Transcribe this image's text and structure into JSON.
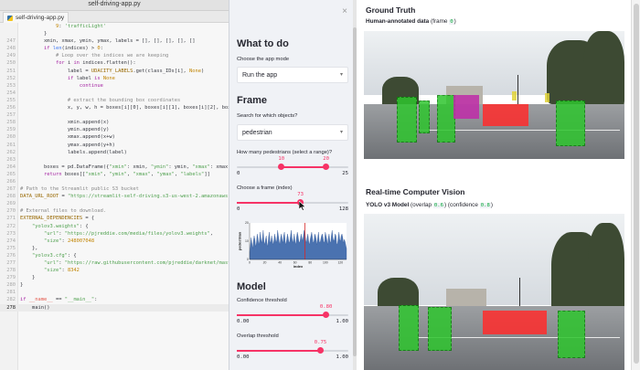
{
  "editor": {
    "window_title": "self-driving-app.py",
    "tab_label": "self-driving-app.py",
    "lines": [
      {
        "n": "",
        "t": [
          [
            "tk-p",
            "            "
          ],
          [
            "tk-n",
            "9"
          ],
          [
            "tk-p",
            ": "
          ],
          [
            "tk-s",
            "'trafficLight'"
          ]
        ]
      },
      {
        "n": "",
        "t": [
          [
            "tk-p",
            "        }"
          ]
        ]
      },
      {
        "n": "247",
        "t": [
          [
            "tk-p",
            "        xmin, xmax, ymin, ymax, labels = [], [], [], [], []"
          ]
        ]
      },
      {
        "n": "248",
        "t": [
          [
            "tk-k",
            "        if "
          ],
          [
            "tk-f",
            "len"
          ],
          [
            "tk-p",
            "(indices) > "
          ],
          [
            "tk-n",
            "0"
          ],
          [
            "tk-p",
            ":"
          ]
        ]
      },
      {
        "n": "249",
        "t": [
          [
            "tk-c",
            "            # Loop over the indices we are keeping"
          ]
        ]
      },
      {
        "n": "250",
        "t": [
          [
            "tk-k",
            "            for "
          ],
          [
            "tk-p",
            "i "
          ],
          [
            "tk-k",
            "in "
          ],
          [
            "tk-p",
            "indices.flatten():"
          ]
        ]
      },
      {
        "n": "251",
        "t": [
          [
            "tk-p",
            "                label = "
          ],
          [
            "tk-x",
            "UDACITY_LABELS"
          ],
          [
            "tk-p",
            ".get(class_IDs[i], "
          ],
          [
            "tk-n",
            "None"
          ],
          [
            "tk-p",
            ")"
          ]
        ]
      },
      {
        "n": "252",
        "t": [
          [
            "tk-k",
            "                if "
          ],
          [
            "tk-p",
            "label "
          ],
          [
            "tk-k",
            "is "
          ],
          [
            "tk-n",
            "None"
          ]
        ]
      },
      {
        "n": "253",
        "t": [
          [
            "tk-k",
            "                    continue"
          ]
        ]
      },
      {
        "n": "254",
        "t": [
          [
            "tk-p",
            ""
          ]
        ]
      },
      {
        "n": "255",
        "t": [
          [
            "tk-c",
            "                # extract the bounding box coordinates"
          ]
        ]
      },
      {
        "n": "256",
        "t": [
          [
            "tk-p",
            "                x, y, w, h = boxes[i][0], boxes[i][1], boxes[i][2], boxes[i][3]"
          ]
        ]
      },
      {
        "n": "257",
        "t": [
          [
            "tk-p",
            ""
          ]
        ]
      },
      {
        "n": "258",
        "t": [
          [
            "tk-p",
            "                xmin.append(x)"
          ]
        ]
      },
      {
        "n": "259",
        "t": [
          [
            "tk-p",
            "                ymin.append(y)"
          ]
        ]
      },
      {
        "n": "260",
        "t": [
          [
            "tk-p",
            "                xmax.append(x+w)"
          ]
        ]
      },
      {
        "n": "261",
        "t": [
          [
            "tk-p",
            "                ymax.append(y+h)"
          ]
        ]
      },
      {
        "n": "262",
        "t": [
          [
            "tk-p",
            "                labels.append(label)"
          ]
        ]
      },
      {
        "n": "263",
        "t": [
          [
            "tk-p",
            ""
          ]
        ]
      },
      {
        "n": "264",
        "t": [
          [
            "tk-p",
            "        boxes = pd.DataFrame({"
          ],
          [
            "tk-s",
            "\"xmin\""
          ],
          [
            "tk-p",
            ": xmin, "
          ],
          [
            "tk-s",
            "\"ymin\""
          ],
          [
            "tk-p",
            ": ymin, "
          ],
          [
            "tk-s",
            "\"xmax\""
          ],
          [
            "tk-p",
            ": xmax, "
          ],
          [
            "tk-s",
            "\"ymax\""
          ],
          [
            "tk-p",
            ": y"
          ]
        ]
      },
      {
        "n": "265",
        "t": [
          [
            "tk-k",
            "        return "
          ],
          [
            "tk-p",
            "boxes[["
          ],
          [
            "tk-s",
            "\"xmin\""
          ],
          [
            "tk-p",
            ", "
          ],
          [
            "tk-s",
            "\"ymin\""
          ],
          [
            "tk-p",
            ", "
          ],
          [
            "tk-s",
            "\"xmax\""
          ],
          [
            "tk-p",
            ", "
          ],
          [
            "tk-s",
            "\"ymax\""
          ],
          [
            "tk-p",
            ", "
          ],
          [
            "tk-s",
            "\"labels\""
          ],
          [
            "tk-p",
            "]]"
          ]
        ]
      },
      {
        "n": "266",
        "t": [
          [
            "tk-p",
            ""
          ]
        ]
      },
      {
        "n": "267",
        "t": [
          [
            "tk-c",
            "# Path to the Streamlit public S3 bucket"
          ]
        ]
      },
      {
        "n": "268",
        "t": [
          [
            "tk-x",
            "DATA_URL_ROOT"
          ],
          [
            "tk-p",
            " = "
          ],
          [
            "tk-s",
            "\"https://streamlit-self-driving.s3-us-west-2.amazonaws.com/\""
          ]
        ]
      },
      {
        "n": "269",
        "t": [
          [
            "tk-p",
            ""
          ]
        ]
      },
      {
        "n": "270",
        "t": [
          [
            "tk-c",
            "# External files to download."
          ]
        ]
      },
      {
        "n": "271",
        "t": [
          [
            "tk-x",
            "EXTERNAL_DEPENDENCIES"
          ],
          [
            "tk-p",
            " = {"
          ]
        ]
      },
      {
        "n": "272",
        "t": [
          [
            "tk-s",
            "    \"yolov3.weights\""
          ],
          [
            "tk-p",
            ": {"
          ]
        ]
      },
      {
        "n": "273",
        "t": [
          [
            "tk-s",
            "        \"url\""
          ],
          [
            "tk-p",
            ": "
          ],
          [
            "tk-s",
            "\"https://pjreddie.com/media/files/yolov3.weights\""
          ],
          [
            "tk-p",
            ","
          ]
        ]
      },
      {
        "n": "274",
        "t": [
          [
            "tk-s",
            "        \"size\""
          ],
          [
            "tk-p",
            ": "
          ],
          [
            "tk-n",
            "248007048"
          ]
        ]
      },
      {
        "n": "275",
        "t": [
          [
            "tk-p",
            "    },"
          ]
        ]
      },
      {
        "n": "276",
        "t": [
          [
            "tk-s",
            "    \"yolov3.cfg\""
          ],
          [
            "tk-p",
            ": {"
          ]
        ]
      },
      {
        "n": "277",
        "t": [
          [
            "tk-s",
            "        \"url\""
          ],
          [
            "tk-p",
            ": "
          ],
          [
            "tk-s",
            "\"https://raw.githubusercontent.com/pjreddie/darknet/master/cfg"
          ]
        ]
      },
      {
        "n": "278",
        "t": [
          [
            "tk-s",
            "        \"size\""
          ],
          [
            "tk-p",
            ": "
          ],
          [
            "tk-n",
            "8342"
          ]
        ]
      },
      {
        "n": "279",
        "t": [
          [
            "tk-p",
            "    }"
          ]
        ]
      },
      {
        "n": "280",
        "t": [
          [
            "tk-p",
            "}"
          ]
        ]
      },
      {
        "n": "281",
        "t": [
          [
            "tk-p",
            ""
          ]
        ]
      },
      {
        "n": "282",
        "t": [
          [
            "tk-k",
            "if "
          ],
          [
            "tk-r",
            "__name__"
          ],
          [
            "tk-p",
            " == "
          ],
          [
            "tk-s",
            "\"__main__\""
          ],
          [
            "tk-p",
            ":"
          ]
        ]
      },
      {
        "n": "278",
        "t": [
          [
            "tk-p",
            "    main()"
          ]
        ],
        "current": true
      }
    ]
  },
  "sidebar": {
    "close_glyph": "×",
    "what_to_do": "What to do",
    "mode_label": "Choose the app mode",
    "mode_value": "Run the app",
    "frame_heading": "Frame",
    "search_label": "Search for which objects?",
    "search_value": "pedestrian",
    "ped_label": "How many pedestrians (select a range)?",
    "ped_range": {
      "low": 10,
      "high": 20,
      "min": "0",
      "max": "25",
      "low_text": "10",
      "high_text": "20"
    },
    "frame_label": "Choose a frame (index)",
    "frame_slider": {
      "value": 73,
      "value_text": "73",
      "min": "0",
      "max": "128",
      "max_num": 128
    },
    "model_heading": "Model",
    "confidence_label": "Confidence threshold",
    "confidence": {
      "value": 0.8,
      "value_text": "0.80",
      "min": "0.00",
      "max": "1.00"
    },
    "overlap_label": "Overlap threshold",
    "overlap": {
      "value": 0.75,
      "value_text": "0.75",
      "min": "0.00",
      "max": "1.00"
    }
  },
  "chart_data": {
    "type": "area",
    "xlabel": "index",
    "ylabel": "pedestrian",
    "xlim": [
      0,
      128
    ],
    "ylim": [
      0,
      20
    ],
    "xticks": [
      "0",
      "20",
      "40",
      "60",
      "80",
      "100",
      "120"
    ],
    "yticks": [
      "0",
      "10",
      "20"
    ],
    "highlight_x": 73,
    "values": [
      4,
      8,
      12,
      9,
      6,
      10,
      13,
      11,
      7,
      9,
      14,
      12,
      8,
      10,
      15,
      11,
      9,
      12,
      16,
      10,
      8,
      11,
      13,
      9,
      7,
      12,
      15,
      10,
      9,
      13,
      11,
      8,
      10,
      14,
      12,
      9,
      11,
      16,
      13,
      10,
      8,
      12,
      14,
      11,
      9,
      13,
      15,
      10,
      8,
      11,
      14,
      12,
      9,
      10,
      13,
      16,
      12,
      9,
      11,
      14,
      10,
      8,
      12,
      15,
      13,
      10,
      9,
      11,
      14,
      12,
      10,
      13,
      16,
      15,
      11,
      9,
      12,
      14,
      10,
      8,
      11,
      13,
      15,
      12,
      9,
      10,
      14,
      13,
      11,
      8,
      12,
      15,
      10,
      9,
      11,
      13,
      14,
      12,
      9,
      10,
      15,
      13,
      11,
      8,
      12,
      14,
      10,
      9,
      13,
      16,
      12,
      10,
      11,
      14,
      13,
      9,
      8,
      12,
      15,
      11,
      10,
      13,
      14,
      12,
      9,
      11,
      10,
      8,
      6
    ]
  },
  "main": {
    "ground_truth_heading": "Ground Truth",
    "gt_label_bold": "Human-annotated data",
    "gt_label_rest": " (frame ",
    "gt_frame": "0",
    "gt_close": ")",
    "rt_heading": "Real-time Computer Vision",
    "rt_label_bold": "YOLO v3 Model",
    "rt_overlap_pre": " (overlap ",
    "rt_overlap": "0.6",
    "rt_conf_pre": ") (confidence ",
    "rt_conf": "0.8",
    "rt_close": ")"
  },
  "colors": {
    "accent": "#f63366",
    "pedestrian_box": "#2ec52e",
    "car_box": "#ff2b2b",
    "truck_box": "#c02aa8",
    "light_box": "#e0d33a",
    "chart_fill": "#4a72b0"
  }
}
